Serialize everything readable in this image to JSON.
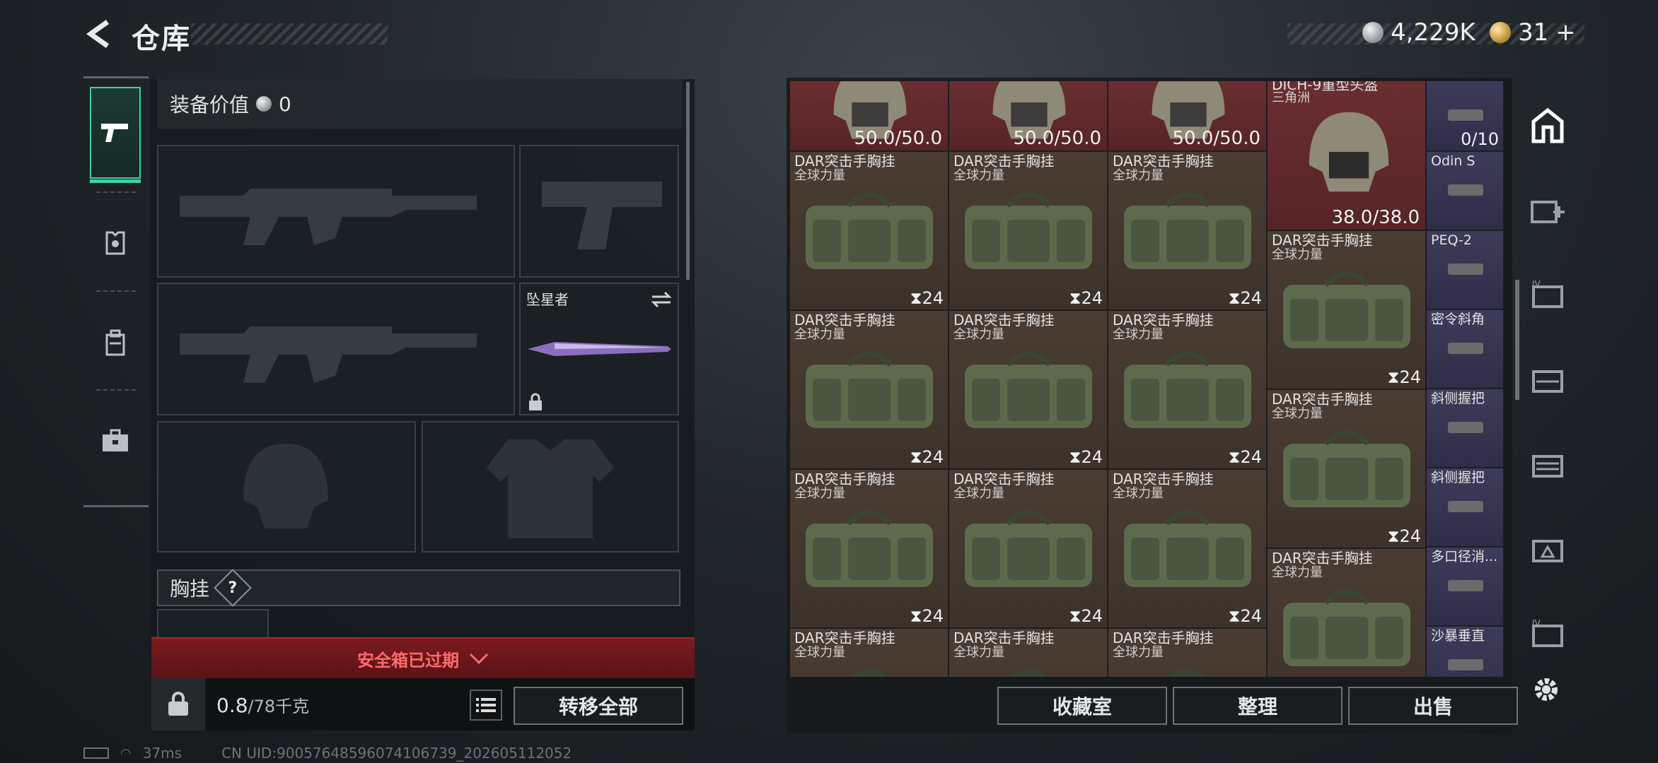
{
  "header": {
    "title": "仓库"
  },
  "currency": {
    "silver": "4,229K",
    "gold": "31",
    "gold_plus": "+"
  },
  "equipment": {
    "value_label": "装备价值",
    "value": "0",
    "melee_name": "坠星者",
    "chest_label": "胸挂",
    "chest_help": "?",
    "safebox_text": "安全箱已过期",
    "weight_current": "0.8",
    "weight_max": "/78千克",
    "transfer_all": "转移全部"
  },
  "stash": {
    "top_row_durability": [
      "50.0/50.0",
      "50.0/50.0",
      "50.0/50.0"
    ],
    "helmet": {
      "name": "DICH-9重型头盔",
      "name2": "三角洲",
      "durability": "38.0/38.0"
    },
    "bag_name": "DAR突击手胸挂",
    "bag_sub": "全球力量",
    "bag_count": "24",
    "attachments": [
      {
        "name": "",
        "count": "0/10"
      },
      {
        "name": "Odin S",
        "count": ""
      },
      {
        "name": "PEQ-2",
        "count": ""
      },
      {
        "name": "密令斜角",
        "count": ""
      },
      {
        "name": "斜侧握把",
        "count": ""
      },
      {
        "name": "斜侧握把",
        "count": ""
      },
      {
        "name": "多口径消...",
        "count": ""
      },
      {
        "name": "沙暴垂直",
        "count": ""
      }
    ]
  },
  "actions": {
    "collection": "收藏室",
    "organize": "整理",
    "sell": "出售"
  },
  "footer": {
    "ping": "37ms",
    "uid": "CN UID:90057648596074106739_202605112052"
  },
  "colors": {
    "accent": "#3fd1a1",
    "warning": "#ff6b6b"
  }
}
